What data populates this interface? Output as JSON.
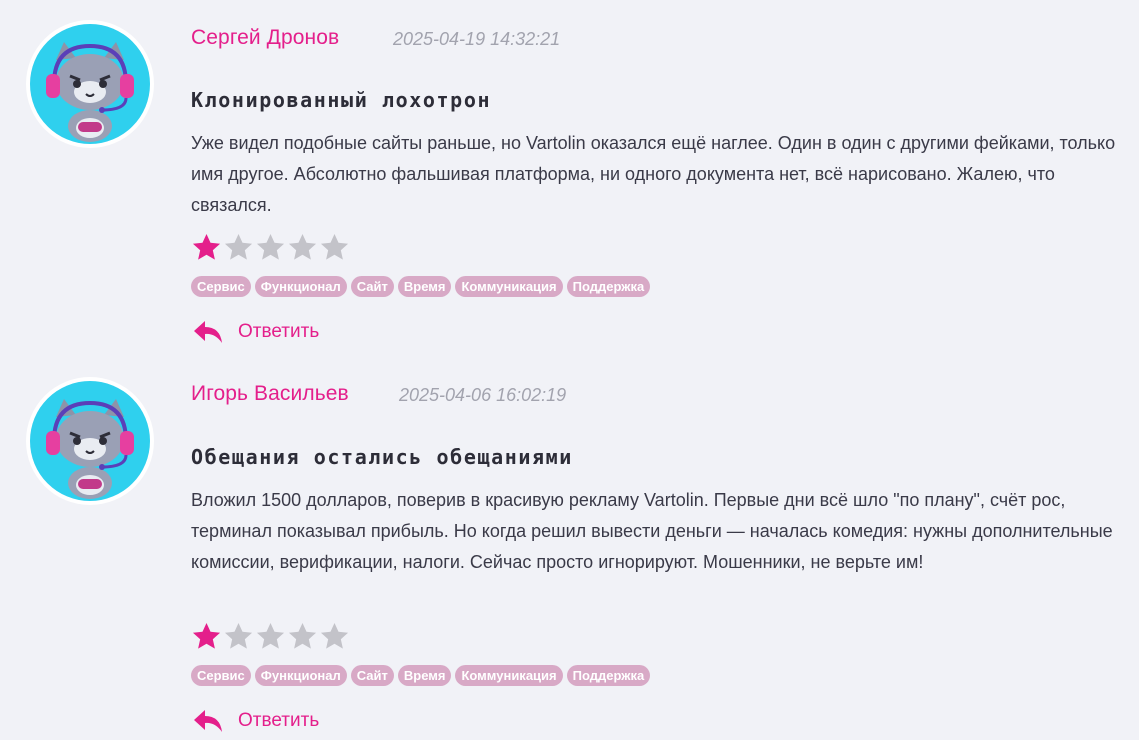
{
  "colors": {
    "accent": "#e41f8b",
    "tag_bg": "#d8a9c6",
    "star_off": "#c3c3c9",
    "avatar_bg": "#2fd0ee",
    "page_bg": "#f1f2f7"
  },
  "reviews": [
    {
      "author": "Сергей Дронов",
      "date": "2025-04-19 14:32:21",
      "title": "Клонированный лохотрон",
      "text": "Уже видел подобные сайты раньше, но Vartolin оказался ещё наглее. Один в один с другими фейками, только имя другое. Абсолютно фальшивая платформа, ни одного документа нет, всё нарисовано. Жалею, что связался.",
      "rating": 1,
      "rating_max": 5,
      "tags": [
        "Сервис",
        "Функционал",
        "Сайт",
        "Время",
        "Коммуникация",
        "Поддержка"
      ],
      "reply_label": "Ответить",
      "avatar_icon": "gamer-cat-avatar-icon"
    },
    {
      "author": "Игорь Васильев",
      "date": "2025-04-06 16:02:19",
      "title": "Обещания остались обещаниями",
      "text": "Вложил 1500 долларов, поверив в красивую рекламу Vartolin. Первые дни всё шло \"по плану\", счёт рос, терминал показывал прибыль. Но когда решил вывести деньги — началась комедия: нужны дополнительные комиссии, верификации, налоги. Сейчас просто игнорируют. Мошенники, не верьте им!",
      "rating": 1,
      "rating_max": 5,
      "tags": [
        "Сервис",
        "Функционал",
        "Сайт",
        "Время",
        "Коммуникация",
        "Поддержка"
      ],
      "reply_label": "Ответить",
      "avatar_icon": "gamer-cat-avatar-icon"
    }
  ]
}
